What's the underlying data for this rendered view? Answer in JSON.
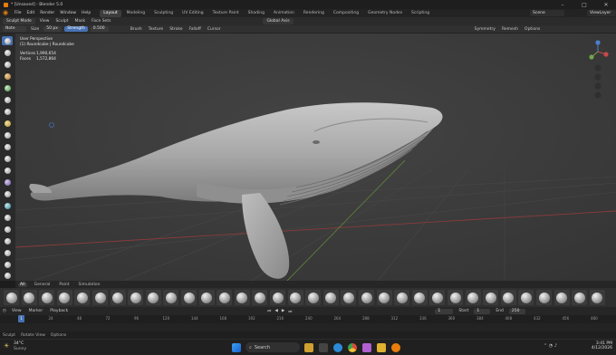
{
  "window": {
    "title": "* [Unsaved] - Blender 5.0"
  },
  "menubar": {
    "menus": [
      "File",
      "Edit",
      "Render",
      "Window",
      "Help"
    ],
    "workspaces": [
      "Layout",
      "Modeling",
      "Sculpting",
      "UV Editing",
      "Texture Paint",
      "Shading",
      "Animation",
      "Rendering",
      "Compositing",
      "Geometry Nodes",
      "Scripting"
    ],
    "active_workspace": "Layout",
    "scene": "Scene",
    "view_layer": "ViewLayer"
  },
  "header": {
    "mode": "Sculpt Mode",
    "menus": [
      "View",
      "Sculpt",
      "Mask",
      "Face Sets"
    ],
    "orientation": "Global Axis",
    "symmetry_label": "Symmetry",
    "remesh_label": "Remesh",
    "options_label": "Options"
  },
  "toolheader": {
    "brush": "Note",
    "size_label": "Size",
    "size_value": "50 px",
    "strength_label": "Strength",
    "strength_value": "0.500",
    "menus": [
      "Brush",
      "Texture",
      "Stroke",
      "Falloff",
      "Cursor"
    ]
  },
  "viewport": {
    "perspective": "User Perspective",
    "object": "(1) Roundcube | Roundcube",
    "stats": {
      "vertices_label": "Vertices",
      "vertices": "1,990,654",
      "faces_label": "Faces",
      "faces": "1,572,864"
    },
    "colors": {
      "background": "#3c3c3c",
      "model": "#b9b9b9",
      "accent": "#4772b3",
      "x_axis": "#c94a4a",
      "y_axis": "#74a34a",
      "z_axis": "#4a7fd0"
    }
  },
  "asset_shelf": {
    "tabs": [
      "All",
      "General",
      "Paint",
      "Simulation"
    ],
    "active_tab": "All"
  },
  "timeline": {
    "menus": [
      "View",
      "Marker",
      "Playback"
    ],
    "current_frame": "1",
    "start_label": "Start",
    "start": "1",
    "end_label": "End",
    "end": "250",
    "ticks": [
      "1",
      "24",
      "48",
      "72",
      "96",
      "120",
      "144",
      "168",
      "192",
      "216",
      "240",
      "264",
      "288",
      "312",
      "336",
      "360",
      "384",
      "408",
      "432",
      "456",
      "480"
    ]
  },
  "statusbar": {
    "items": [
      "Sculpt",
      "Rotate View",
      "Options"
    ]
  },
  "taskbar": {
    "weather_temp": "34°C",
    "weather_desc": "Sunny",
    "search_placeholder": "Search",
    "time": "3:41 PM",
    "date": "4/12/2026"
  }
}
